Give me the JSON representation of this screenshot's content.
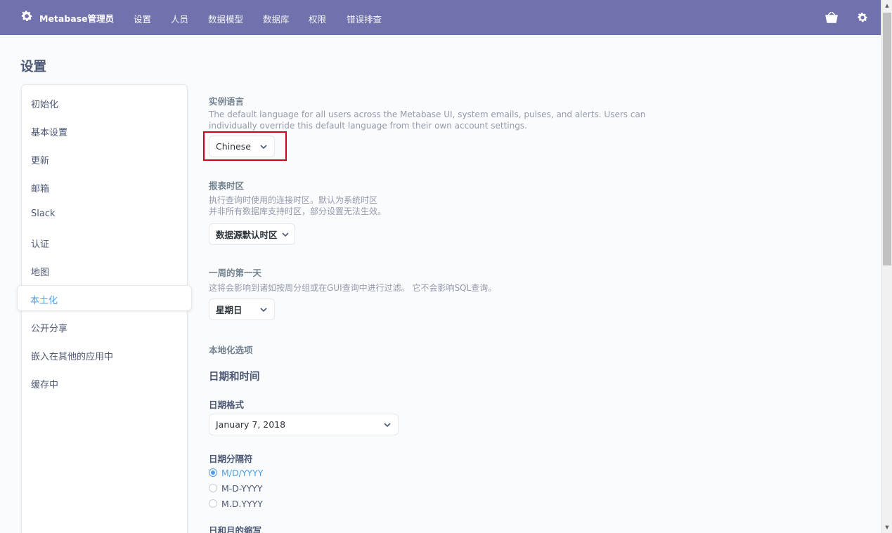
{
  "nav": {
    "brand": "Metabase管理员",
    "links": [
      "设置",
      "人员",
      "数据模型",
      "数据库",
      "权限",
      "错误排查"
    ],
    "active_index": 0,
    "icons": [
      "basket-icon",
      "gear-icon"
    ]
  },
  "page_title": "设置",
  "sidebar": {
    "items": [
      "初始化",
      "基本设置",
      "更新",
      "邮箱",
      "Slack",
      "认证",
      "地图",
      "本土化",
      "公开分享",
      "嵌入在其他的应用中",
      "缓存中"
    ],
    "active": "本土化"
  },
  "language": {
    "label": "实例语言",
    "desc_line1": "The default language for all users across the Metabase UI, system emails, pulses, and alerts. Users can",
    "desc_line2": "individually override this default language from their own account settings.",
    "value": "Chinese"
  },
  "timezone": {
    "label": "报表时区",
    "desc_line1": "执行查询时使用的连接时区。默认为系统时区",
    "desc_line2": "并非所有数据库支持时区，部分设置无法生效。",
    "value": "数据源默认时区"
  },
  "first_day": {
    "label": "一周的第一天",
    "desc": "这将会影响到诸如按周分组或在GUI查询中进行过滤。 它不会影响SQL查询。",
    "value": "星期日"
  },
  "locale_options": {
    "label": "本地化选项",
    "section": "日期和时间",
    "date_format_label": "日期格式",
    "date_format_value": "January 7, 2018",
    "separator_label": "日期分隔符",
    "separators": [
      "M/D/YYYY",
      "M-D-YYYY",
      "M.D.YYYY"
    ],
    "separator_selected": 0,
    "abbrev_label": "日和月的缩写"
  },
  "colors": {
    "nav_bg": "#7172ad",
    "accent": "#509ee3",
    "highlight": "#d0021b"
  }
}
